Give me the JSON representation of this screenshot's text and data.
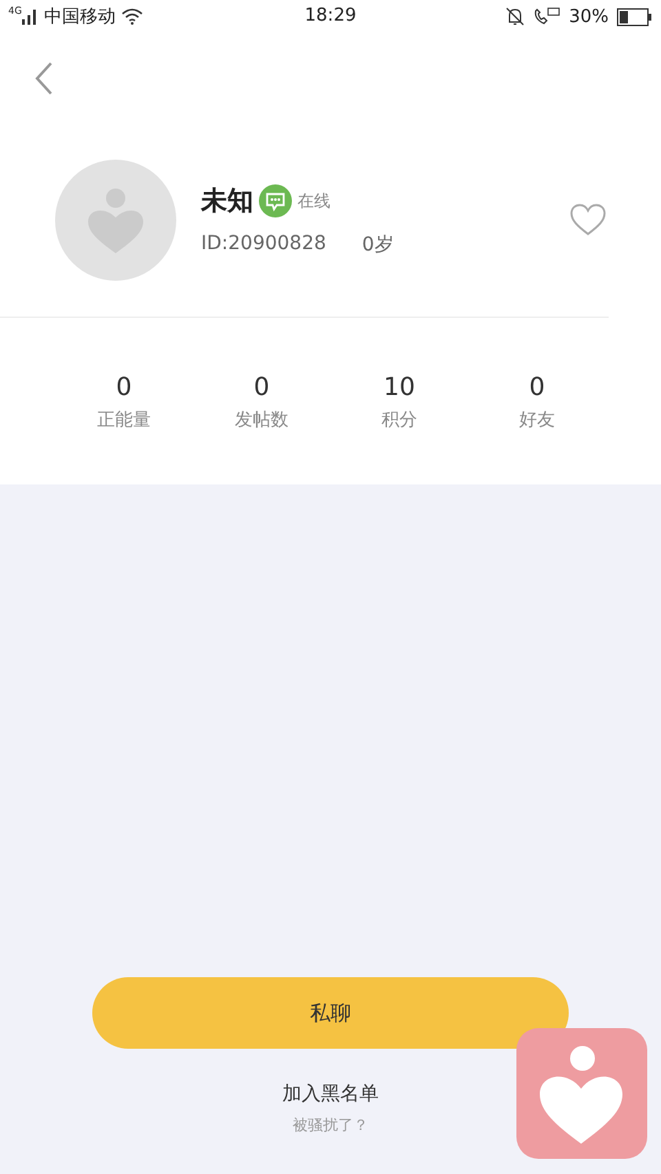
{
  "status_bar": {
    "network": "4G",
    "carrier": "中国移动",
    "time": "18:29",
    "battery_text": "30%"
  },
  "profile": {
    "name": "未知",
    "status": "在线",
    "id_text": "ID:20900828",
    "age": "0岁",
    "favorited": false
  },
  "stats": [
    {
      "value": "0",
      "label": "正能量"
    },
    {
      "value": "0",
      "label": "发帖数"
    },
    {
      "value": "10",
      "label": "积分"
    },
    {
      "value": "0",
      "label": "好友"
    }
  ],
  "chat_button": "私聊",
  "blacklist_button": "加入黑名单",
  "harassed_link": "被骚扰了？"
}
